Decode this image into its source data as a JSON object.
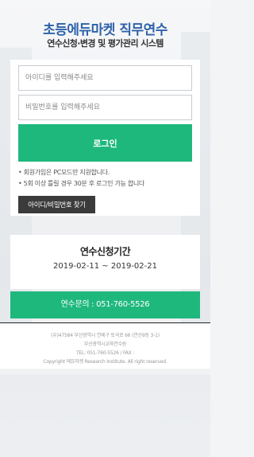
{
  "header": {
    "title": "초등에듀마켓 직무연수",
    "subtitle": "연수신청·변경 및 평가관리 시스템"
  },
  "login": {
    "id_placeholder": "아이디를 입력해주세요",
    "pw_placeholder": "비밀번호를 입력해주세요",
    "login_label": "로그인",
    "notices": [
      "• 회원가입은 PC모드만 지원합니다.",
      "• 5회 이상 틀릴 경우 30분 후 로그인 가능 합니다"
    ],
    "find_label": "아이디/비밀번호 찾기"
  },
  "period": {
    "title": "연수신청기간",
    "dates": "2019-02-11 ~ 2019-02-21"
  },
  "contact": {
    "label": "연수문의 : 051-760-5526"
  },
  "footer": {
    "lines": [
      "(우)47584 부산광역시 연제구 토곡로 66 (연산9동 3-1)",
      "부산광역시교육연수원",
      "TEL: 051-760-5526 / FAX :",
      "Copyright 에듀마켓 Research Institute. All right reserved."
    ]
  },
  "colors": {
    "accent": "#1eb87d",
    "title_blue": "#2e62a8",
    "dark_button": "#3b3b3b"
  }
}
